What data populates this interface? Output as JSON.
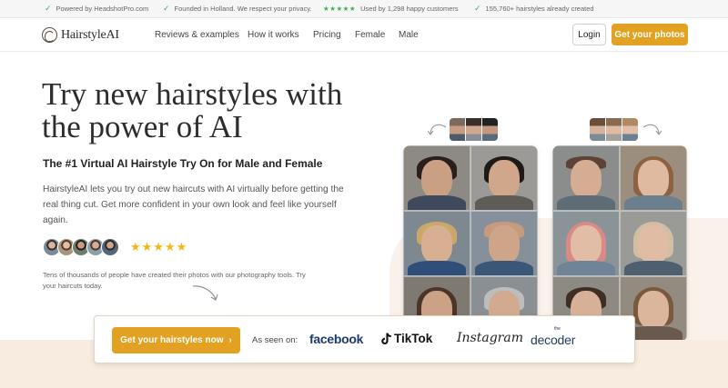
{
  "topbar": {
    "item1": "Powered by HeadshotPro.com",
    "item2": "Founded in Holland. We respect your privacy.",
    "item3_stars": "★★★★★",
    "item3": "Used by 1,298 happy customers",
    "item4": "155,760+ hairstyles already created"
  },
  "nav": {
    "logo": "HairstyleAI",
    "links": [
      "Reviews & examples",
      "How it works",
      "Pricing",
      "Female",
      "Male"
    ],
    "login": "Login",
    "cta": "Get your photos"
  },
  "hero": {
    "title": "Try new hairstyles with the power of AI",
    "subtitle": "The #1 Virtual AI Hairstyle Try On for Male and Female",
    "description": "HairstyleAI lets you try out new haircuts with AI virtually before getting the real thing cut. Get more confident in your own look and feel like yourself again.",
    "rating_stars": "★★★★★",
    "social_note": "Tens of thousands of people have created their photos with our photography tools. Try your haircuts today."
  },
  "cta_bar": {
    "button": "Get your hairstyles now",
    "button_arrow": "›",
    "as_seen_on": "As seen on:",
    "press": {
      "facebook": "facebook",
      "tiktok": "TikTok",
      "instagram": "Instagram",
      "decoder": "decoder",
      "decoder_prefix": "the"
    }
  },
  "colors": {
    "accent": "#e2a121",
    "check": "#3fae5a",
    "stars": "#f2b61b",
    "band": "#f8ebe0"
  },
  "icons": {
    "check": "check-icon",
    "arrow": "curved-arrow-icon",
    "logo": "hairstyleai-logo-icon",
    "tiktok": "tiktok-logo-icon"
  }
}
